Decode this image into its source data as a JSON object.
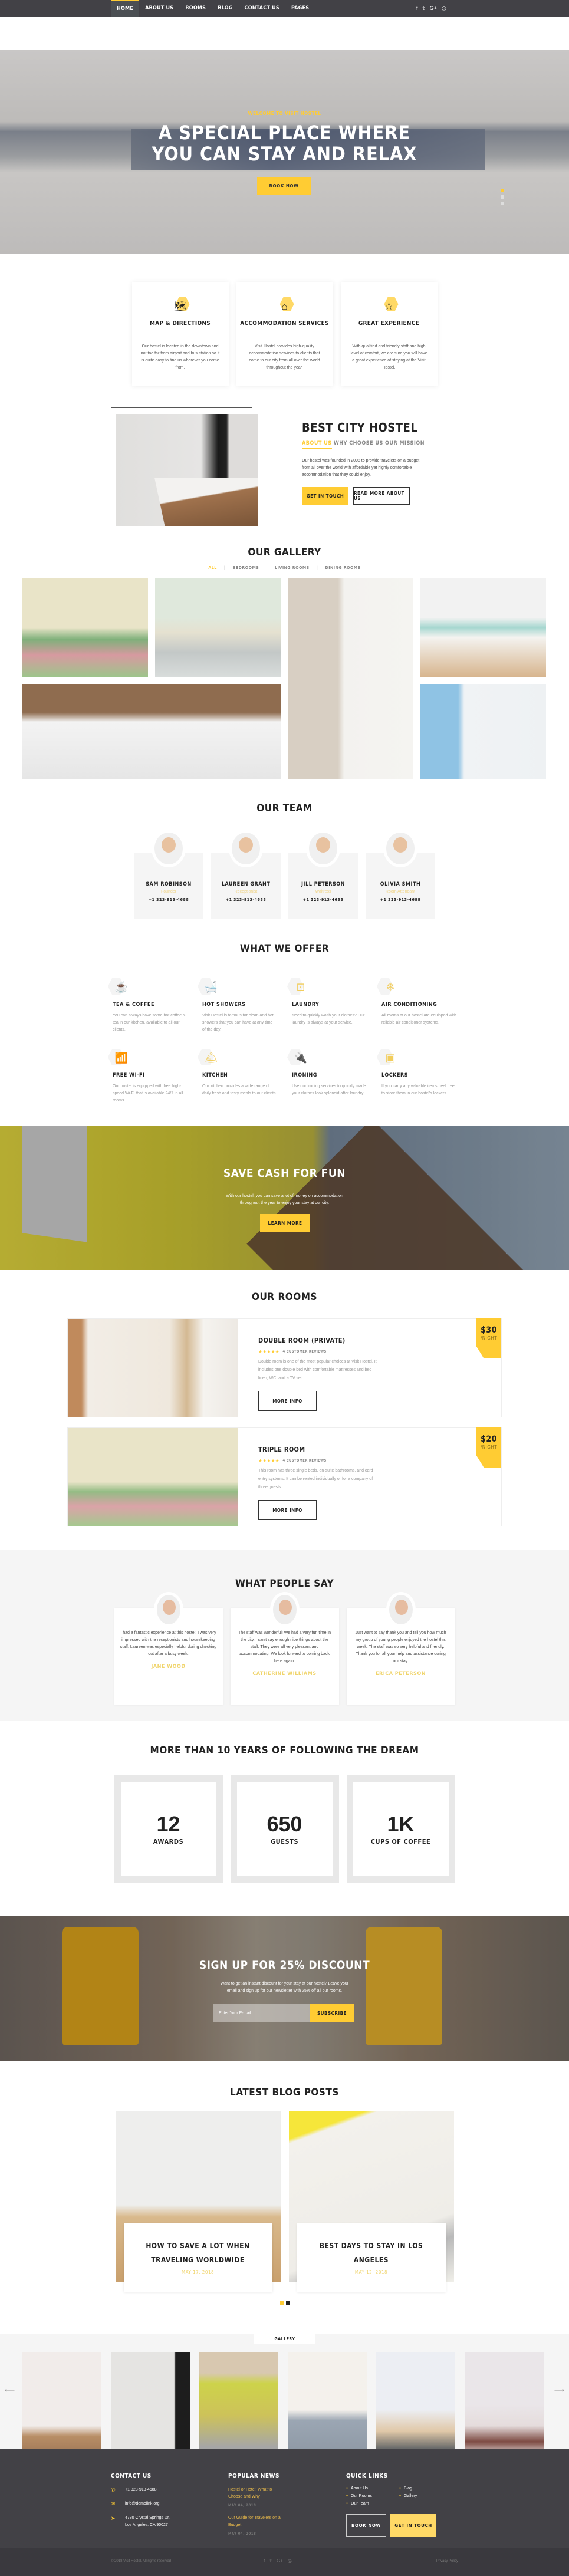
{
  "nav": {
    "items": [
      "Home",
      "About Us",
      "Rooms",
      "Blog",
      "Contact Us",
      "Pages"
    ],
    "active_index": 0,
    "social": [
      "f",
      "𝕥",
      "G+",
      "◎"
    ],
    "social_names": [
      "facebook-icon",
      "twitter-icon",
      "google-plus-icon",
      "instagram-icon"
    ]
  },
  "hero": {
    "subtitle": "Welcome to Visit Hostel",
    "title_line1": "A Special Place Where",
    "title_line2": "You Can Stay and Relax",
    "button": "Book Now",
    "slides": 3,
    "active_slide": 1
  },
  "features": [
    {
      "icon": "map-icon",
      "glyph": "🗺",
      "title": "Map & Directions",
      "text": "Our hostel is located in the downtown and not too far from airport and bus station so it is quite easy to find us wherever you come from."
    },
    {
      "icon": "house-icon",
      "glyph": "⌂",
      "title": "Accommodation Services",
      "text": "Visit Hostel provides high-quality accommodation services to clients that come to our city from all over the world throughout the year."
    },
    {
      "icon": "star-icon",
      "glyph": "☆",
      "title": "Great Experience",
      "text": "With qualified and friendly staff and high level of comfort, we are sure you will have a great experience of staying at the Visit Hostel."
    }
  ],
  "about": {
    "title": "Best City Hostel",
    "tabs": [
      "About Us",
      "Why Choose Us",
      "Our Mission"
    ],
    "active_tab": 0,
    "text": "Our hostel was founded in 2008 to provide travelers on a budget from all over the world with affordable yet highly comfortable accommodation that they could enjoy.",
    "btn_primary": "Get in Touch",
    "btn_secondary": "Read More About Us"
  },
  "gallery": {
    "title": "Our Gallery",
    "filters": [
      "All",
      "Bedrooms",
      "Living Rooms",
      "Dining Rooms"
    ],
    "active_filter": 0
  },
  "team": {
    "title": "Our Team",
    "members": [
      {
        "name": "Sam Robinson",
        "role": "Founder",
        "phone": "+1 323-913-4688"
      },
      {
        "name": "Laureen Grant",
        "role": "Receptionist",
        "phone": "+1 323-913-4688"
      },
      {
        "name": "Jill Peterson",
        "role": "Waitress",
        "phone": "+1 323-913-4688"
      },
      {
        "name": "Olivia Smith",
        "role": "Room Attendant",
        "phone": "+1 323-913-4688"
      }
    ]
  },
  "offer": {
    "title": "What We Offer",
    "items": [
      {
        "icon": "coffee-cup-icon",
        "glyph": "☕",
        "title": "Tea & Coffee",
        "text": "You can always have some hot coffee & tea in our kitchen, available to all our clients."
      },
      {
        "icon": "shower-icon",
        "glyph": "🛁",
        "title": "Hot Showers",
        "text": "Visit Hostel is famous for clean and hot showers that you can have at any time of the day."
      },
      {
        "icon": "washing-machine-icon",
        "glyph": "⊡",
        "title": "Laundry",
        "text": "Need to quickly wash your clothes? Our laundry is always at your service."
      },
      {
        "icon": "snowflake-icon",
        "glyph": "❄",
        "title": "Air Conditioning",
        "text": "All rooms at our hostel are equipped with reliable air conditioner systems."
      },
      {
        "icon": "wifi-icon",
        "glyph": "📶",
        "title": "Free Wi-Fi",
        "text": "Our hostel is equipped with free high-speed Wi-Fi that is available 24/7 in all rooms."
      },
      {
        "icon": "cloche-icon",
        "glyph": "🛎",
        "title": "Kitchen",
        "text": "Our kitchen provides a wide range of daily fresh and tasty meals to our clients."
      },
      {
        "icon": "plug-icon",
        "glyph": "🔌",
        "title": "Ironing",
        "text": "Use our ironing services to quickly made your clothes look splendid after laundry."
      },
      {
        "icon": "safe-icon",
        "glyph": "▣",
        "title": "Lockers",
        "text": "If you carry any valuable items, feel free to store them in our hostel's lockers."
      }
    ]
  },
  "cash": {
    "title": "Save Cash for Fun",
    "text_line1": "With our hostel, you can save a lot of money on accommodation",
    "text_line2": "throughout the year to enjoy your stay at our city.",
    "button": "Learn More"
  },
  "rooms": {
    "title": "Our Rooms",
    "list": [
      {
        "name": "Double Room (Private)",
        "rating": 4.5,
        "stars": "★★★★✬",
        "reviews": "4 Customer Reviews",
        "text": "Double room is one of the most popular choices at Visit Hostel. It includes one double bed with comfortable mattresses and bed linen, WC, and a TV set.",
        "button": "More Info",
        "price": "$30",
        "per": "/Night"
      },
      {
        "name": "Triple Room",
        "rating": 4.5,
        "stars": "★★★★✬",
        "reviews": "4 Customer Reviews",
        "text": "This room has three single beds, en-suite bathrooms, and card entry systems. It can be rented individually or for a company of three guests.",
        "button": "More Info",
        "price": "$20",
        "per": "/Night"
      }
    ]
  },
  "testimonials": {
    "title": "What People Say",
    "list": [
      {
        "text": "I had a fantastic experience at this hostel; I was very impressed with the receptionists and housekeeping staff. Laureen was especially helpful during checking out after a busy week.",
        "name": "Jane Wood"
      },
      {
        "text": "The staff was wonderful! We had a very fun time in the city. I can't say enough nice things about the staff. They were all very pleasant and accommodating. We look forward to coming back here again.",
        "name": "Catherine Williams"
      },
      {
        "text": "Just want to say thank you and tell you how much my group of young people enjoyed the hostel this week. The staff was so very helpful and friendly. Thank you for all your help and assistance during our stay.",
        "name": "Erica Peterson"
      }
    ]
  },
  "stats": {
    "title": "More Than 10 Years of Following the Dream",
    "items": [
      {
        "value": "12",
        "label": "Awards"
      },
      {
        "value": "650",
        "label": "Guests"
      },
      {
        "value": "1K",
        "label": "Cups of Coffee"
      }
    ]
  },
  "signup": {
    "title": "Sign Up for 25% Discount",
    "text_line1": "Want to get an instant discount for your stay at our hostel? Leave your",
    "text_line2": "email and sign up for our newsletter with 25% off all our rooms.",
    "placeholder": "Enter Your E-mail",
    "button": "Subscribe"
  },
  "blog": {
    "title": "Latest Blog Posts",
    "posts": [
      {
        "title": "How to Save a Lot When Traveling Worldwide",
        "date": "May 17, 2018"
      },
      {
        "title": "Best Days to Stay in Los Angeles",
        "date": "May 12, 2018"
      }
    ],
    "pages": 2,
    "active_page": 1
  },
  "gallery_strip": {
    "label": "Gallery",
    "prev": "⟵",
    "next": "⟶"
  },
  "footer": {
    "contact_title": "Contact Us",
    "phone": "+1 323-913-4688",
    "email": "info@demolink.org",
    "address_line1": "4730 Crystal Springs Dr,",
    "address_line2": "Los Angeles, CA 90027",
    "news_title": "Popular News",
    "news": [
      {
        "title": "Hostel or Hotel: What to Choose and Why",
        "date": "May 04, 2018"
      },
      {
        "title": "Our Guide for Travelers on a Budget",
        "date": "May 04, 2018"
      }
    ],
    "links_title": "Quick Links",
    "links": [
      "About Us",
      "Blog",
      "Our Rooms",
      "Gallery",
      "Our Team"
    ],
    "btn_book": "Book Now",
    "btn_touch": "Get in Touch",
    "copyright": "© 2018 Visit Hostel. All rights reserved",
    "privacy": "Privacy Policy"
  },
  "colors": {
    "accent": "#ffcc33",
    "dark": "#424146",
    "light_bg": "#f5f5f5"
  }
}
